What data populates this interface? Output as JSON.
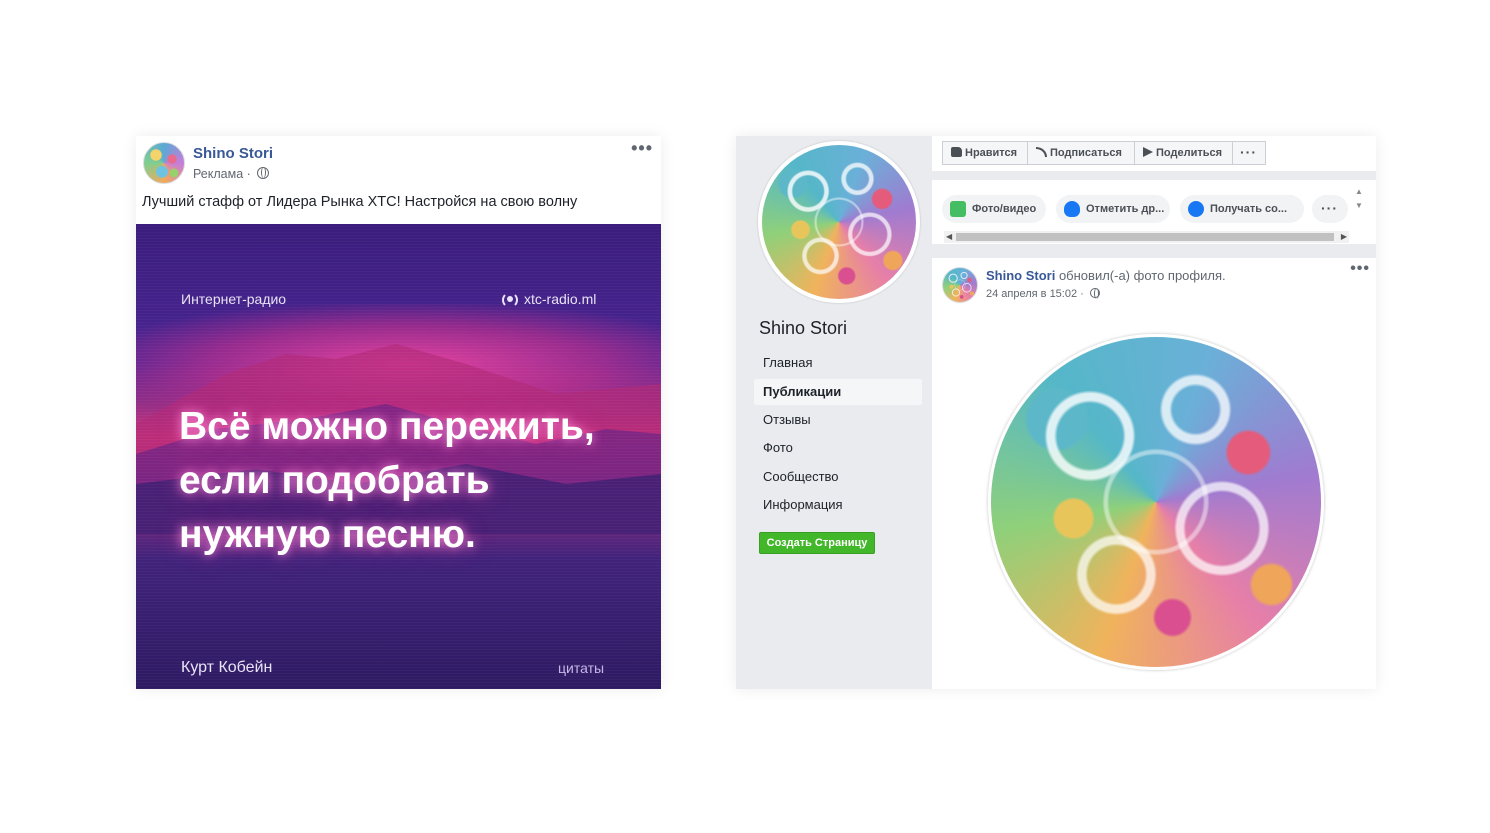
{
  "ad_post": {
    "page_name": "Shino Stori",
    "sponsored": "Реклама ·",
    "text": "Лучший стафф от Лидера Рынка XTC! Настройся на свою волну",
    "image": {
      "label_left": "Интернет-радио",
      "label_right": "xtc-radio.ml",
      "quote_line1": "Всё можно пережить,",
      "quote_line2": "если подобрать",
      "quote_line3": "нужную песню.",
      "author": "Курт Кобейн",
      "tag": "цитаты"
    },
    "icons": {
      "more": "more-options-icon",
      "audience": "globe-icon",
      "radio": "radio-broadcast-icon"
    }
  },
  "fb_page": {
    "title": "Shino Stori",
    "nav": [
      "Главная",
      "Публикации",
      "Отзывы",
      "Фото",
      "Сообщество",
      "Информация"
    ],
    "active_nav": "Публикации",
    "create_page_button": "Создать Страницу",
    "actions": {
      "like": "Нравится",
      "follow": "Подписаться",
      "share": "Поделиться",
      "more": "···"
    },
    "compose": {
      "photo_video": "Фото/видео",
      "tag_friends": "Отметить др...",
      "get_messages": "Получать со...",
      "more": "···"
    },
    "post": {
      "author": "Shino Stori",
      "action_text": " обновил(-а) фото профиля.",
      "time": "24 апреля в 15:02 ·"
    }
  },
  "colors": {
    "link_blue": "#385898",
    "create_green": "#42b72a",
    "sidebar_bg": "#e9ebee",
    "ad_purple": "#3a1d7c",
    "ad_pink": "#d2357c"
  }
}
